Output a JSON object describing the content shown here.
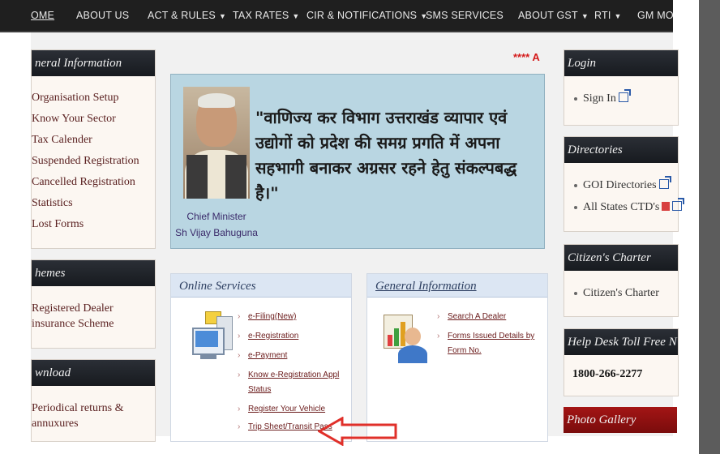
{
  "nav": {
    "items": [
      {
        "label": "OME"
      },
      {
        "label": "ABOUT US"
      },
      {
        "label": "ACT & RULES"
      },
      {
        "label": "TAX RATES"
      },
      {
        "label": "CIR & NOTIFICATIONS"
      },
      {
        "label": "SMS SERVICES"
      },
      {
        "label": "ABOUT GST"
      },
      {
        "label": "RTI"
      },
      {
        "label": "GM MOD"
      }
    ]
  },
  "marquee": "**** A",
  "left": {
    "general_info": {
      "title": "neral Information",
      "items": [
        "Organisation Setup",
        "Know Your Sector",
        "Tax Calender",
        "Suspended Registration",
        "Cancelled Registration",
        "Statistics",
        "Lost Forms"
      ]
    },
    "schemes": {
      "title": "hemes",
      "items": [
        "Registered Dealer",
        "insurance Scheme"
      ]
    },
    "download": {
      "title": "wnload",
      "items": [
        "Periodical returns &",
        "annuxures"
      ]
    }
  },
  "banner": {
    "quote": "\"वाणिज्य कर विभाग उत्तराखंड व्यापार एवं उद्योगों को प्रदेश की समग्र प्रगति में अपना सहभागी बनाकर अग्रसर रहने हेतु संकल्पबद्ध है।\"",
    "cm_title": "Chief Minister",
    "cm_name": "Sh Vijay Bahuguna"
  },
  "online_services": {
    "title": "Online Services",
    "links": [
      "e-Filing(New)",
      "e-Registration",
      "e-Payment",
      "Know e-Registration Appl Status",
      "Register Your Vehicle",
      "Trip Sheet/Transit Pass"
    ]
  },
  "general_information": {
    "title": "General Information",
    "links": [
      "Search A Dealer",
      "Forms Issued Details by Form No."
    ]
  },
  "right": {
    "login": {
      "title": "Login",
      "items": [
        "Sign In"
      ]
    },
    "directories": {
      "title": "Directories",
      "items": [
        "GOI Directories",
        "All States CTD's"
      ]
    },
    "citizen": {
      "title": "Citizen's Charter",
      "items": [
        "Citizen's Charter"
      ]
    },
    "helpdesk": {
      "title": "Help Desk Toll Free N",
      "number": "1800-266-2277"
    },
    "gallery": {
      "title": "Photo Gallery"
    }
  },
  "colors": {
    "nav_bg": "#1f1f1f",
    "panel_head": "#1f2329",
    "accent_red": "#a31515",
    "link": "#6a1a1a",
    "arrow": "#e0302a"
  }
}
